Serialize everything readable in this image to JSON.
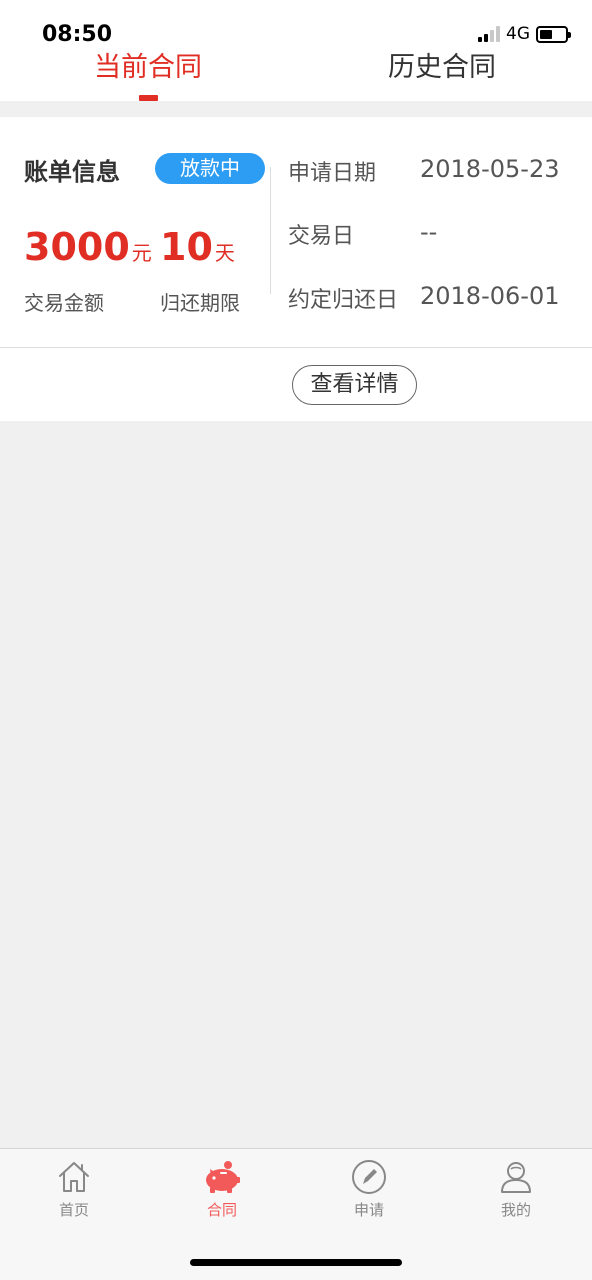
{
  "status_bar": {
    "time": "08:50",
    "network": "4G",
    "battery_level": 0.5
  },
  "tabs": [
    {
      "label": "当前合同",
      "active": true
    },
    {
      "label": "历史合同",
      "active": false
    }
  ],
  "bill": {
    "title": "账单信息",
    "status": "放款中",
    "amount": "3000",
    "amount_unit": "元",
    "amount_label": "交易金额",
    "term": "10",
    "term_unit": "天",
    "term_label": "归还期限",
    "info": [
      {
        "label": "申请日期",
        "value": "2018-05-23"
      },
      {
        "label": "交易日",
        "value": "--"
      },
      {
        "label": "约定归还日",
        "value": "2018-06-01"
      }
    ],
    "detail_button": "查看详情"
  },
  "bottom_nav": [
    {
      "label": "首页",
      "icon": "home-icon",
      "active": false
    },
    {
      "label": "合同",
      "icon": "piggy-bank-icon",
      "active": true
    },
    {
      "label": "申请",
      "icon": "pencil-icon",
      "active": false
    },
    {
      "label": "我的",
      "icon": "user-icon",
      "active": false
    }
  ],
  "colors": {
    "accent": "#e02e24",
    "badge": "#2d9cf3",
    "nav_active": "#f25a5a"
  }
}
